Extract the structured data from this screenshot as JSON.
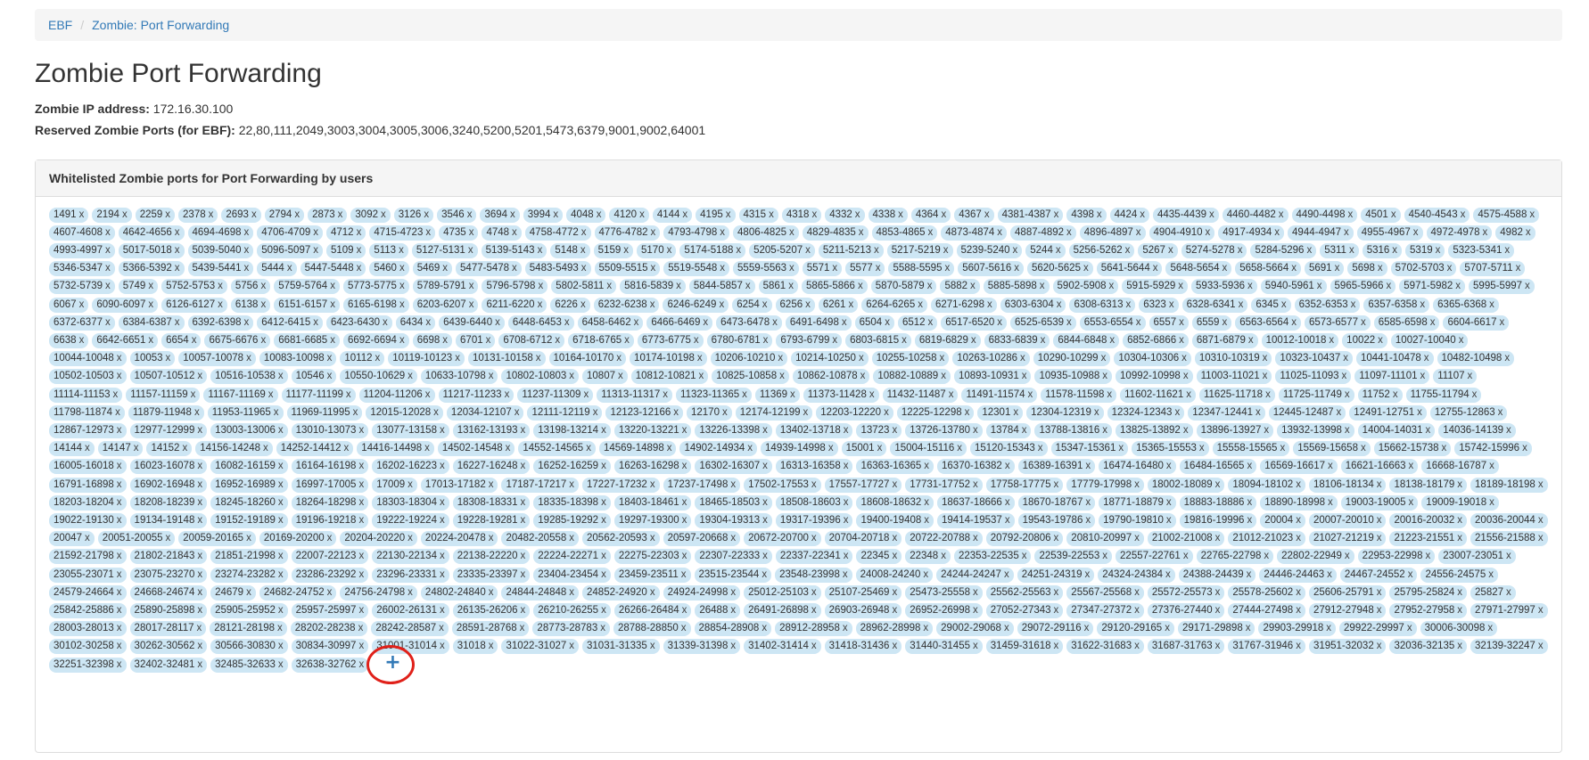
{
  "breadcrumb": {
    "home": "EBF",
    "current": "Zombie: Port Forwarding",
    "separator": "/"
  },
  "page_title": "Zombie Port Forwarding",
  "zombie_ip": {
    "label": "Zombie IP address:",
    "value": "172.16.30.100"
  },
  "reserved_ports": {
    "label": "Reserved Zombie Ports (for EBF):",
    "value": "22,80,111,2049,3003,3004,3005,3006,3240,5200,5201,5473,6379,9001,9002,64001"
  },
  "panel": {
    "title": "Whitelisted Zombie ports for Port Forwarding by users",
    "remove_symbol": "x",
    "add_symbol": "+"
  },
  "colors": {
    "tag_bg": "#cde6f4",
    "link": "#337ab7",
    "highlight": "#e0211a"
  },
  "ports": [
    "1491",
    "2194",
    "2259",
    "2378",
    "2693",
    "2794",
    "2873",
    "3092",
    "3126",
    "3546",
    "3694",
    "3994",
    "4048",
    "4120",
    "4144",
    "4195",
    "4315",
    "4318",
    "4332",
    "4338",
    "4364",
    "4367",
    "4381-4387",
    "4398",
    "4424",
    "4435-4439",
    "4460-4482",
    "4490-4498",
    "4501",
    "4540-4543",
    "4575-4588",
    "4607-4608",
    "4642-4656",
    "4694-4698",
    "4706-4709",
    "4712",
    "4715-4723",
    "4735",
    "4748",
    "4758-4772",
    "4776-4782",
    "4793-4798",
    "4806-4825",
    "4829-4835",
    "4853-4865",
    "4873-4874",
    "4887-4892",
    "4896-4897",
    "4904-4910",
    "4917-4934",
    "4944-4947",
    "4955-4967",
    "4972-4978",
    "4982",
    "4993-4997",
    "5017-5018",
    "5039-5040",
    "5096-5097",
    "5109",
    "5113",
    "5127-5131",
    "5139-5143",
    "5148",
    "5159",
    "5170",
    "5174-5188",
    "5205-5207",
    "5211-5213",
    "5217-5219",
    "5239-5240",
    "5244",
    "5256-5262",
    "5267",
    "5274-5278",
    "5284-5296",
    "5311",
    "5316",
    "5319",
    "5323-5341",
    "5346-5347",
    "5366-5392",
    "5439-5441",
    "5444",
    "5447-5448",
    "5460",
    "5469",
    "5477-5478",
    "5483-5493",
    "5509-5515",
    "5519-5548",
    "5559-5563",
    "5571",
    "5577",
    "5588-5595",
    "5607-5616",
    "5620-5625",
    "5641-5644",
    "5648-5654",
    "5658-5664",
    "5691",
    "5698",
    "5702-5703",
    "5707-5711",
    "5732-5739",
    "5749",
    "5752-5753",
    "5756",
    "5759-5764",
    "5773-5775",
    "5789-5791",
    "5796-5798",
    "5802-5811",
    "5816-5839",
    "5844-5857",
    "5861",
    "5865-5866",
    "5870-5879",
    "5882",
    "5885-5898",
    "5902-5908",
    "5915-5929",
    "5933-5936",
    "5940-5961",
    "5965-5966",
    "5971-5982",
    "5995-5997",
    "6067",
    "6090-6097",
    "6126-6127",
    "6138",
    "6151-6157",
    "6165-6198",
    "6203-6207",
    "6211-6220",
    "6226",
    "6232-6238",
    "6246-6249",
    "6254",
    "6256",
    "6261",
    "6264-6265",
    "6271-6298",
    "6303-6304",
    "6308-6313",
    "6323",
    "6328-6341",
    "6345",
    "6352-6353",
    "6357-6358",
    "6365-6368",
    "6372-6377",
    "6384-6387",
    "6392-6398",
    "6412-6415",
    "6423-6430",
    "6434",
    "6439-6440",
    "6448-6453",
    "6458-6462",
    "6466-6469",
    "6473-6478",
    "6491-6498",
    "6504",
    "6512",
    "6517-6520",
    "6525-6539",
    "6553-6554",
    "6557",
    "6559",
    "6563-6564",
    "6573-6577",
    "6585-6598",
    "6604-6617",
    "6638",
    "6642-6651",
    "6654",
    "6675-6676",
    "6681-6685",
    "6692-6694",
    "6698",
    "6701",
    "6708-6712",
    "6718-6765",
    "6773-6775",
    "6780-6781",
    "6793-6799",
    "6803-6815",
    "6819-6829",
    "6833-6839",
    "6844-6848",
    "6852-6866",
    "6871-6879",
    "10012-10018",
    "10022",
    "10027-10040",
    "10044-10048",
    "10053",
    "10057-10078",
    "10083-10098",
    "10112",
    "10119-10123",
    "10131-10158",
    "10164-10170",
    "10174-10198",
    "10206-10210",
    "10214-10250",
    "10255-10258",
    "10263-10286",
    "10290-10299",
    "10304-10306",
    "10310-10319",
    "10323-10437",
    "10441-10478",
    "10482-10498",
    "10502-10503",
    "10507-10512",
    "10516-10538",
    "10546",
    "10550-10629",
    "10633-10798",
    "10802-10803",
    "10807",
    "10812-10821",
    "10825-10858",
    "10862-10878",
    "10882-10889",
    "10893-10931",
    "10935-10988",
    "10992-10998",
    "11003-11021",
    "11025-11093",
    "11097-11101",
    "11107",
    "11114-11153",
    "11157-11159",
    "11167-11169",
    "11177-11199",
    "11204-11206",
    "11217-11233",
    "11237-11309",
    "11313-11317",
    "11323-11365",
    "11369",
    "11373-11428",
    "11432-11487",
    "11491-11574",
    "11578-11598",
    "11602-11621",
    "11625-11718",
    "11725-11749",
    "11752",
    "11755-11794",
    "11798-11874",
    "11879-11948",
    "11953-11965",
    "11969-11995",
    "12015-12028",
    "12034-12107",
    "12111-12119",
    "12123-12166",
    "12170",
    "12174-12199",
    "12203-12220",
    "12225-12298",
    "12301",
    "12304-12319",
    "12324-12343",
    "12347-12441",
    "12445-12487",
    "12491-12751",
    "12755-12863",
    "12867-12973",
    "12977-12999",
    "13003-13006",
    "13010-13073",
    "13077-13158",
    "13162-13193",
    "13198-13214",
    "13220-13221",
    "13226-13398",
    "13402-13718",
    "13723",
    "13726-13780",
    "13784",
    "13788-13816",
    "13825-13892",
    "13896-13927",
    "13932-13998",
    "14004-14031",
    "14036-14139",
    "14144",
    "14147",
    "14152",
    "14156-14248",
    "14252-14412",
    "14416-14498",
    "14502-14548",
    "14552-14565",
    "14569-14898",
    "14902-14934",
    "14939-14998",
    "15001",
    "15004-15116",
    "15120-15343",
    "15347-15361",
    "15365-15553",
    "15558-15565",
    "15569-15658",
    "15662-15738",
    "15742-15996",
    "16005-16018",
    "16023-16078",
    "16082-16159",
    "16164-16198",
    "16202-16223",
    "16227-16248",
    "16252-16259",
    "16263-16298",
    "16302-16307",
    "16313-16358",
    "16363-16365",
    "16370-16382",
    "16389-16391",
    "16474-16480",
    "16484-16565",
    "16569-16617",
    "16621-16663",
    "16668-16787",
    "16791-16898",
    "16902-16948",
    "16952-16989",
    "16997-17005",
    "17009",
    "17013-17182",
    "17187-17217",
    "17227-17232",
    "17237-17498",
    "17502-17553",
    "17557-17727",
    "17731-17752",
    "17758-17775",
    "17779-17998",
    "18002-18089",
    "18094-18102",
    "18106-18134",
    "18138-18179",
    "18189-18198",
    "18203-18204",
    "18208-18239",
    "18245-18260",
    "18264-18298",
    "18303-18304",
    "18308-18331",
    "18335-18398",
    "18403-18461",
    "18465-18503",
    "18508-18603",
    "18608-18632",
    "18637-18666",
    "18670-18767",
    "18771-18879",
    "18883-18886",
    "18890-18998",
    "19003-19005",
    "19009-19018",
    "19022-19130",
    "19134-19148",
    "19152-19189",
    "19196-19218",
    "19222-19224",
    "19228-19281",
    "19285-19292",
    "19297-19300",
    "19304-19313",
    "19317-19396",
    "19400-19408",
    "19414-19537",
    "19543-19786",
    "19790-19810",
    "19816-19996",
    "20004",
    "20007-20010",
    "20016-20032",
    "20036-20044",
    "20047",
    "20051-20055",
    "20059-20165",
    "20169-20200",
    "20204-20220",
    "20224-20478",
    "20482-20558",
    "20562-20593",
    "20597-20668",
    "20672-20700",
    "20704-20718",
    "20722-20788",
    "20792-20806",
    "20810-20997",
    "21002-21008",
    "21012-21023",
    "21027-21219",
    "21223-21551",
    "21556-21588",
    "21592-21798",
    "21802-21843",
    "21851-21998",
    "22007-22123",
    "22130-22134",
    "22138-22220",
    "22224-22271",
    "22275-22303",
    "22307-22333",
    "22337-22341",
    "22345",
    "22348",
    "22353-22535",
    "22539-22553",
    "22557-22761",
    "22765-22798",
    "22802-22949",
    "22953-22998",
    "23007-23051",
    "23055-23071",
    "23075-23270",
    "23274-23282",
    "23286-23292",
    "23296-23331",
    "23335-23397",
    "23404-23454",
    "23459-23511",
    "23515-23544",
    "23548-23998",
    "24008-24240",
    "24244-24247",
    "24251-24319",
    "24324-24384",
    "24388-24439",
    "24446-24463",
    "24467-24552",
    "24556-24575",
    "24579-24664",
    "24668-24674",
    "24679",
    "24682-24752",
    "24756-24798",
    "24802-24840",
    "24844-24848",
    "24852-24920",
    "24924-24998",
    "25012-25103",
    "25107-25469",
    "25473-25558",
    "25562-25563",
    "25567-25568",
    "25572-25573",
    "25578-25602",
    "25606-25791",
    "25795-25824",
    "25827",
    "25842-25886",
    "25890-25898",
    "25905-25952",
    "25957-25997",
    "26002-26131",
    "26135-26206",
    "26210-26255",
    "26266-26484",
    "26488",
    "26491-26898",
    "26903-26948",
    "26952-26998",
    "27052-27343",
    "27347-27372",
    "27376-27440",
    "27444-27498",
    "27912-27948",
    "27952-27958",
    "27971-27997",
    "28003-28013",
    "28017-28117",
    "28121-28198",
    "28202-28238",
    "28242-28587",
    "28591-28768",
    "28773-28783",
    "28788-28850",
    "28854-28908",
    "28912-28958",
    "28962-28998",
    "29002-29068",
    "29072-29116",
    "29120-29165",
    "29171-29898",
    "29903-29918",
    "29922-29997",
    "30006-30098",
    "30102-30258",
    "30262-30562",
    "30566-30830",
    "30834-30997",
    "31001-31014",
    "31018",
    "31022-31027",
    "31031-31335",
    "31339-31398",
    "31402-31414",
    "31418-31436",
    "31440-31455",
    "31459-31618",
    "31622-31683",
    "31687-31763",
    "31767-31946",
    "31951-32032",
    "32036-32135",
    "32139-32247",
    "32251-32398",
    "32402-32481",
    "32485-32633",
    "32638-32762"
  ]
}
